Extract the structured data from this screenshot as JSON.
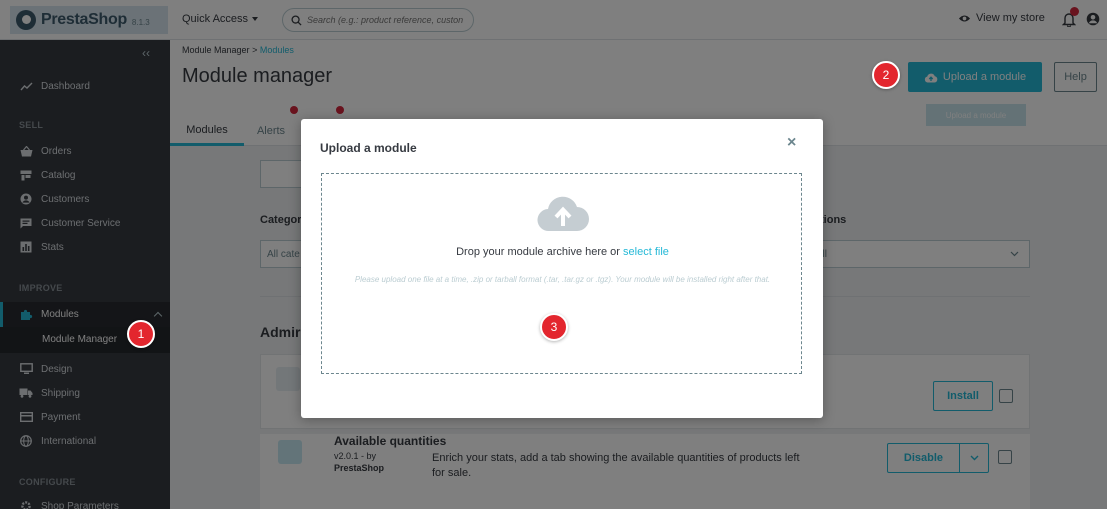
{
  "topbar": {
    "logo_text": "PrestaShop",
    "version": "8.1.3",
    "quick_access": "Quick Access",
    "search_placeholder": "Search (e.g.: product reference, custon",
    "view_store": "View my store"
  },
  "sidebar": {
    "dashboard": "Dashboard",
    "section_sell": "SELL",
    "orders": "Orders",
    "catalog": "Catalog",
    "customers": "Customers",
    "customer_service": "Customer Service",
    "stats": "Stats",
    "section_improve": "IMPROVE",
    "modules": "Modules",
    "module_manager": "Module Manager",
    "design": "Design",
    "shipping": "Shipping",
    "payment": "Payment",
    "international": "International",
    "section_configure": "CONFIGURE",
    "shop_parameters": "Shop Parameters"
  },
  "header": {
    "breadcrumb_parent": "Module Manager",
    "breadcrumb_sep": ">",
    "breadcrumb_current": "Modules",
    "title": "Module manager",
    "upload_button": "Upload a module",
    "help_button": "Help",
    "tooltip": "Upload a module",
    "tab_modules": "Modules",
    "tab_alerts": "Alerts"
  },
  "background": {
    "category_label": "Categor",
    "category_value": "All cate",
    "status_label": "tions",
    "status_value": "all",
    "section_heading": "Admir",
    "install_button": "Install",
    "module2_name": "Available quantities",
    "module2_version": "v2.0.1 - by",
    "module2_author": "PrestaShop",
    "module2_desc": "Enrich your stats, add a tab showing the available quantities of products left for sale.",
    "disable_button": "Disable"
  },
  "modal": {
    "title": "Upload a module",
    "close": "×",
    "drop_text": "Drop your module archive here or ",
    "select_file": "select file",
    "hint": "Please upload one file at a time, .zip or tarball format (.tar, .tar.gz or .tgz). Your module will be installed right after that."
  },
  "steps": [
    "1",
    "2",
    "3"
  ],
  "colors": {
    "accent": "#25b9d7",
    "sidebar_bg": "#363a41",
    "step_marker": "#e3262e",
    "alert_badge": "#d2263d"
  }
}
